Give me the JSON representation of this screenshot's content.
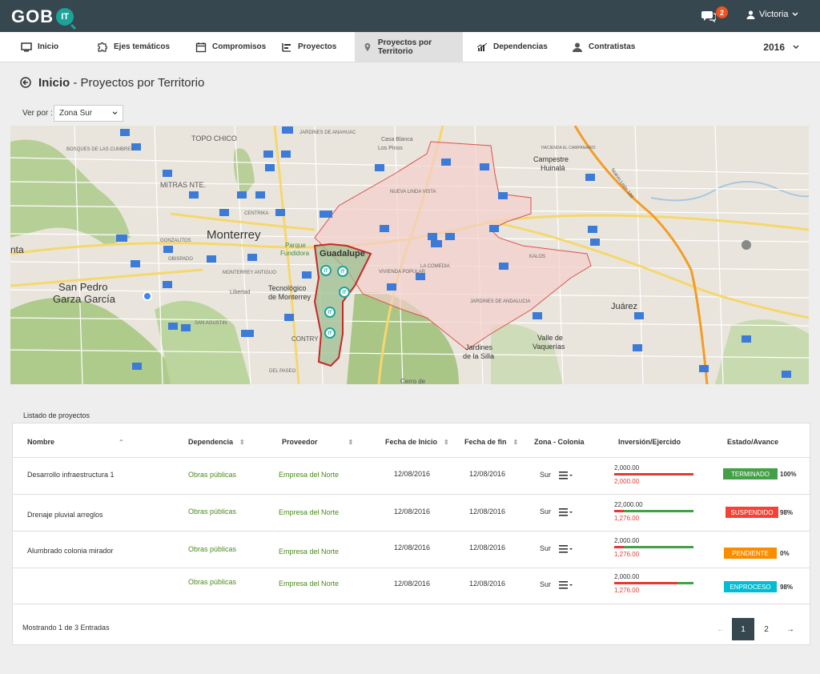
{
  "header": {
    "logo_text": "GOB",
    "logo_badge": "IT",
    "notification_count": "2",
    "user_name": "Victoria"
  },
  "nav": {
    "items": [
      {
        "label": "Inicio",
        "icon": "monitor-icon"
      },
      {
        "label": "Ejes temáticos",
        "icon": "puzzle-icon"
      },
      {
        "label": "Compromisos",
        "icon": "calendar-icon"
      },
      {
        "label": "Proyectos",
        "icon": "list-icon"
      },
      {
        "label": "Proyectos por Territorio",
        "icon": "map-pin-icon",
        "active": true
      },
      {
        "label": "Dependencias",
        "icon": "chart-icon"
      },
      {
        "label": "Contratistas",
        "icon": "user-icon"
      }
    ],
    "year": "2016"
  },
  "breadcrumb": {
    "root": "Inicio",
    "separator": " - ",
    "current": "Proyectos por Territorio"
  },
  "filter": {
    "label": "Ver por :",
    "value": "Zona Sur"
  },
  "map": {
    "labels": {
      "monterrey": "Monterrey",
      "san_pedro": "San Pedro",
      "garza_garcia": "Garza García",
      "guadalupe": "Guadalupe",
      "juarez": "Juárez",
      "topo_chico": "TOPO CHICO",
      "mitras_nte": "MITRAS NTE.",
      "parque": "Parque",
      "fundidora": "Fundidora",
      "tecnologico": "Tecnológico",
      "de_monterrey": "de Monterrey",
      "campestre": "Campestre",
      "huinala": "Huinalá",
      "valle": "Valle de",
      "vaquerias": "Vaquerías",
      "jardines": "Jardines",
      "de_la_silla": "de la Silla",
      "cerro": "Cerro de",
      "centrika": "CENTRIKA",
      "obispado": "OBISPADO",
      "gonzalitos": "GONZALITOS",
      "la_comedia": "LA COMEDIA",
      "vivienda_popular": "VIVIENDA POPULAR",
      "jardines_andalucia": "JARDINES DE ANDALUCIA",
      "nueva_linda_vista": "NUEVA LINDA VISTA",
      "kalos": "KALOS",
      "libertad": "Libertad",
      "del_paseo": "DEL PASEO",
      "contry": "CONTRY",
      "bosques": "BOSQUES DE LAS CUMBRES",
      "jardines_anahuac": "JARDINES DE ANAHUAC",
      "casa_blanca": "Casa Blanca",
      "los_pinos": "Los Pinos",
      "hacienda": "HACIENDA EL CAMPANARIO",
      "nuevo_leon_road": "Nuevo León 100",
      "monterrey_antiguo": "MONTERREY ANTIGUO",
      "san_agustin": "SAN AGUSTIN",
      "nta": "nta"
    },
    "marker_label": "IT"
  },
  "list": {
    "title": "Listado de proyectos",
    "columns": [
      "Nombre",
      "Dependencia",
      "Proveedor",
      "Fecha de Inicio",
      "Fecha de fin",
      "Zona - Colonia",
      "Inversión/Ejercido",
      "Estado/Avance"
    ],
    "rows": [
      {
        "nombre": "Desarrollo infraestructura 1",
        "dependencia": "Obras públicas",
        "proveedor": "Empresa del Norte",
        "inicio": "12/08/2016",
        "fin": "12/08/2016",
        "zona": "Sur",
        "inversion": "2,000.00",
        "ejercido": "2,000.00",
        "avance_fraction": 0.0,
        "estado": "TERMINADO",
        "estado_color": "#43a047",
        "avance": "100%"
      },
      {
        "nombre": "Drenaje pluvial arreglos",
        "dependencia": "Obras públicas",
        "proveedor": "Empresa del Norte",
        "inicio": "12/08/2016",
        "fin": "12/08/2016",
        "zona": "Sur",
        "inversion": "22,000.00",
        "ejercido": "1,276.00",
        "avance_fraction": 0.88,
        "estado": "SUSPENDIDO",
        "estado_color": "#f44336",
        "avance": "98%"
      },
      {
        "nombre": "Alumbrado colonia mirador",
        "dependencia": "Obras públicas",
        "proveedor": "Empresa del Norte",
        "inicio": "12/08/2016",
        "fin": "12/08/2016",
        "zona": "Sur",
        "inversion": "2,000.00",
        "ejercido": "1,276.00",
        "avance_fraction": 0.88,
        "estado": "PENDIENTE",
        "estado_color": "#fb8c00",
        "avance": "0%"
      },
      {
        "nombre": "",
        "dependencia": "Obras públicas",
        "proveedor": "Empresa del Norte",
        "inicio": "12/08/2016",
        "fin": "12/08/2016",
        "zona": "Sur",
        "inversion": "2,000.00",
        "ejercido": "1,276.00",
        "avance_fraction": 0.2,
        "estado": "ENPROCESO",
        "estado_color": "#00bcd4",
        "avance": "98%"
      }
    ],
    "footer": "Mostrando 1 de  3 Entradas",
    "pagination": {
      "prev": "←",
      "pages": [
        "1",
        "2"
      ],
      "next": "→"
    }
  }
}
